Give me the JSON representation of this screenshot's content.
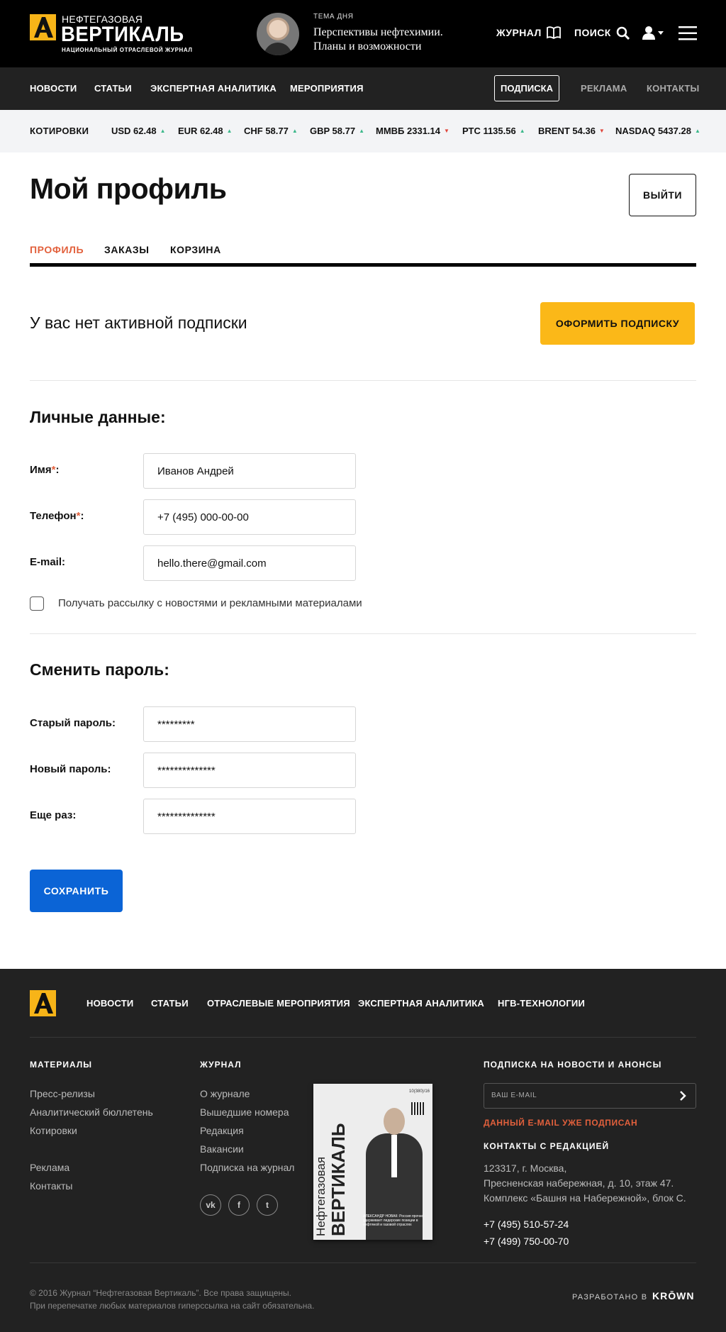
{
  "header": {
    "logo_small": "НЕФТЕГАЗОВАЯ",
    "logo_big": "ВЕРТИКАЛЬ",
    "logo_sub": "НАЦИОНАЛЬНЫЙ ОТРАСЛЕВОЙ ЖУРНАЛ",
    "tema_label": "ТЕМА ДНЯ",
    "tema_text": "Перспективы нефтехимии. Планы и возможности",
    "journal": "ЖУРНАЛ",
    "search": "ПОИСК"
  },
  "nav": {
    "items": [
      "НОВОСТИ",
      "СТАТЬИ",
      "ЭКСПЕРТНАЯ АНАЛИТИКА",
      "МЕРОПРИЯТИЯ"
    ],
    "subscription": "ПОДПИСКА",
    "ads": "РЕКЛАМА",
    "contacts": "КОНТАКТЫ"
  },
  "quotes": {
    "label": "КОТИРОВКИ",
    "items": [
      {
        "text": "USD 62.48",
        "dir": "up"
      },
      {
        "text": "EUR 62.48",
        "dir": "up"
      },
      {
        "text": "CHF 58.77",
        "dir": "up"
      },
      {
        "text": "GBP 58.77",
        "dir": "up"
      },
      {
        "text": "ММВБ 2331.14",
        "dir": "down"
      },
      {
        "text": "РТС 1135.56",
        "dir": "up"
      },
      {
        "text": "BRENT 54.36",
        "dir": "down"
      },
      {
        "text": "NASDAQ 5437.28",
        "dir": "up"
      }
    ]
  },
  "profile": {
    "title": "Мой профиль",
    "logout": "ВЫЙТИ",
    "tabs": [
      "ПРОФИЛЬ",
      "ЗАКАЗЫ",
      "КОРЗИНА"
    ],
    "no_subscription": "У вас нет активной подписки",
    "subscribe_button": "ОФОРМИТЬ ПОДПИСКУ"
  },
  "personal": {
    "title": "Личные данные:",
    "name_label": "Имя",
    "name_value": "Иванов Андрей",
    "phone_label": "Телефон",
    "phone_value": "+7 (495) 000-00-00",
    "email_label": "E-mail:",
    "email_value": "hello.there@gmail.com",
    "required_mark": "*",
    "colon": ":",
    "newsletter": "Получать рассылку с новостями и рекламными материалами"
  },
  "password": {
    "title": "Сменить пароль:",
    "old_label": "Старый пароль:",
    "old_value": "*********",
    "new_label": "Новый пароль:",
    "new_value": "**************",
    "repeat_label": "Еще раз:",
    "repeat_value": "**************",
    "save": "СОХРАНИТЬ"
  },
  "footer": {
    "nav": [
      "НОВОСТИ",
      "СТАТЬИ",
      "ОТРАСЛЕВЫЕ МЕРОПРИЯТИЯ",
      "ЭКСПЕРТНАЯ АНАЛИТИКА",
      "НГВ-ТЕХНОЛОГИИ"
    ],
    "materials_title": "МАТЕРИАЛЫ",
    "materials": [
      "Пресс-релизы",
      "Аналитический бюллетень",
      "Котировки",
      "Реклама",
      "Контакты"
    ],
    "journal_title": "ЖУРНАЛ",
    "journal": [
      "О журнале",
      "Вышедшие номера",
      "Редакция",
      "Вакансии",
      "Подписка на журнал"
    ],
    "social": [
      "vk",
      "f",
      "t"
    ],
    "magazine": {
      "small": "Нефтегазовая",
      "big": "ВЕРТИКАЛЬ",
      "issue": "10(380)/16",
      "caption": "АЛЕКСАНДР НОВАК: Россия прочно удерживает лидерские позиции в нефтяной и газовой отраслях"
    },
    "subscribe_title": "ПОДПИСКА НА НОВОСТИ И АНОНСЫ",
    "subscribe_placeholder": "ВАШ E-MAIL",
    "subscribe_error": "ДАННЫЙ E-MAIL УЖЕ ПОДПИСАН",
    "contacts_title": "КОНТАКТЫ С РЕДАКЦИЕЙ",
    "address_1": "123317, г. Москва,",
    "address_2": "Пресненская набережная, д. 10, этаж 47.",
    "address_3": "Комплекс «Башня на Набережной», блок С.",
    "phone_1": "+7 (495) 510-57-24",
    "phone_2": "+7 (499) 750-00-70",
    "copyright_1": "© 2016 Журнал “Нефтегазовая Вертикаль”. Все права защищены.",
    "copyright_2": "При перепечатке любых материалов гиперссылка на сайт обязательна.",
    "developed_by": "РАЗРАБОТАНО В",
    "developer": "KRŌWN"
  },
  "colors": {
    "brand_yellow": "#f7b418",
    "accent_orange": "#e2603c",
    "save_blue": "#0b64d6",
    "up": "#3bb88a",
    "down": "#e0463c"
  }
}
